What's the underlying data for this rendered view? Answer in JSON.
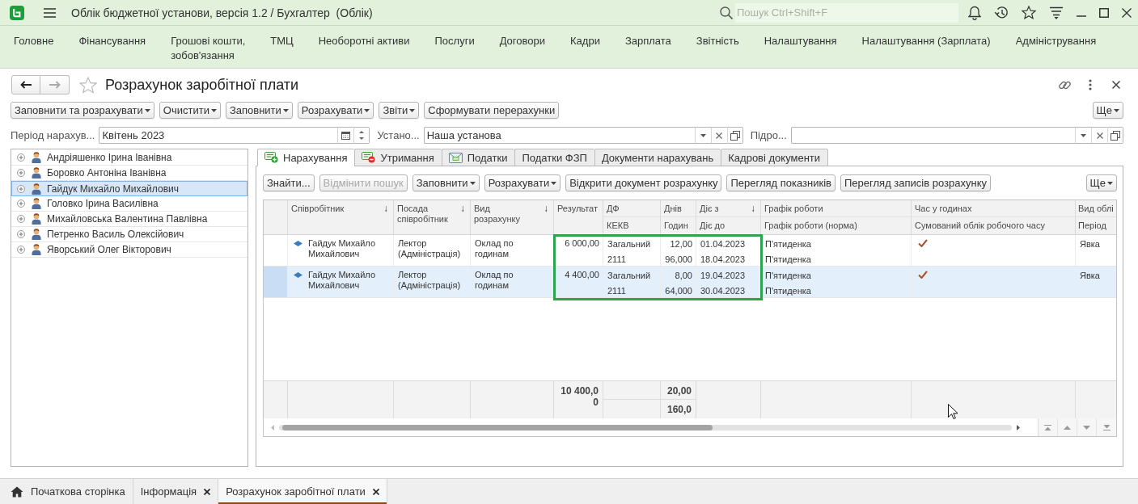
{
  "app": {
    "title": "Облік бюджетної установи, версія 1.2 / Бухгалтер  (Облік)",
    "search": {
      "placeholder": "Пошук Ctrl+Shift+F"
    }
  },
  "sections": [
    "Головне",
    "Фінансування",
    "Грошові кошти,\nзобов'язання",
    "ТМЦ",
    "Необоротні активи",
    "Послуги",
    "Договори",
    "Кадри",
    "Зарплата",
    "Звітність",
    "Налаштування",
    "Налаштування (Зарплата)",
    "Адміністрування"
  ],
  "form": {
    "title": "Розрахунок заробітної плати",
    "favorite": false,
    "navigation": {
      "back_disabled": false,
      "forward_disabled": true
    },
    "commands": [
      {
        "label": "Заповнити та розрахувати",
        "menu": true
      },
      {
        "label": "Очистити",
        "menu": true
      },
      {
        "label": "Заповнити",
        "menu": true
      },
      {
        "label": "Розрахувати",
        "menu": true
      },
      {
        "label": "Звіти",
        "menu": true
      },
      {
        "label": "Сформувати перерахунки",
        "menu": false
      }
    ],
    "more": "Ще",
    "fields": [
      {
        "kind": "period",
        "label": "Період нарахув...",
        "value": "Квітень 2023"
      },
      {
        "kind": "reference",
        "label": "Устано...",
        "value": "Наша установа"
      },
      {
        "kind": "reference",
        "label": "Підро..."
      }
    ]
  },
  "employees": [
    {
      "name": "Андріяшенко Ірина Іванівна",
      "selected": false
    },
    {
      "name": "Боровко Антоніна Іванівна",
      "selected": false
    },
    {
      "name": "Гайдук Михайло Михайлович",
      "selected": true
    },
    {
      "name": "Головко Ірина Василівна",
      "selected": false
    },
    {
      "name": "Михайловська Валентина Павлівна",
      "selected": false
    },
    {
      "name": "Петренко Василь Олексійович",
      "selected": false
    },
    {
      "name": "Яворський Олег Вікторович",
      "selected": false
    }
  ],
  "tabs": [
    {
      "label": "Нарахування",
      "kind": "accrual",
      "selected": true
    },
    {
      "label": "Утримання",
      "kind": "deduction",
      "selected": false
    },
    {
      "label": "Податки",
      "kind": "tax",
      "selected": false
    },
    {
      "label": "Податки ФЗП",
      "kind": "plain",
      "selected": false
    },
    {
      "label": "Документи нарахувань",
      "kind": "plain",
      "selected": false
    },
    {
      "label": "Кадрові документи",
      "kind": "plain",
      "selected": false
    }
  ],
  "table": {
    "commands": [
      {
        "label": "Знайти...",
        "menu": false,
        "disabled": false
      },
      {
        "label": "Відмінити пошук",
        "menu": false,
        "disabled": true
      },
      {
        "label": "Заповнити",
        "menu": true,
        "disabled": false
      },
      {
        "label": "Розрахувати",
        "menu": true,
        "disabled": false
      },
      {
        "label": "Відкрити документ розрахунку",
        "menu": false,
        "disabled": false
      },
      {
        "label": "Перегляд показників",
        "menu": false,
        "disabled": false
      },
      {
        "label": "Перегляд записів розрахунку",
        "menu": false,
        "disabled": false
      }
    ],
    "more": "Ще",
    "columns": [
      {
        "top": "Співробітник",
        "sort": "↓"
      },
      {
        "top": "Посада співробітник",
        "sort": "↓"
      },
      {
        "top": "Вид розрахунку",
        "sort": "↓"
      },
      {
        "top": "Результат"
      },
      {
        "top": "ДФ",
        "bottom": "КЕКВ"
      },
      {
        "top": "Днів",
        "bottom": "Годин"
      },
      {
        "top": "Діє з",
        "bottom": "Діє до",
        "sort": "↓"
      },
      {
        "top": "Графік роботи",
        "bottom": "Графік роботи (норма)"
      },
      {
        "top": "Час у годинах",
        "bottom": "Сумований облік робочого часу"
      },
      {
        "top": "Вид облі",
        "bottom": "Період"
      }
    ],
    "rows": [
      {
        "selected": false,
        "employee": "Гайдук Михайло Михайлович",
        "position": "Лектор (Адміністрація)",
        "calculation": "Оклад по годинам",
        "result": "6 000,00",
        "fund": "Загальний",
        "kekv": "2111",
        "days": "12,00",
        "hours": "96,000",
        "from": "01.04.2023",
        "to": "18.04.2023",
        "schedule": "П'ятиденка",
        "schedule_norm": "П'ятиденка",
        "summed_hours": true,
        "accounting_kind": "Явка"
      },
      {
        "selected": true,
        "employee": "Гайдук Михайло Михайлович",
        "position": "Лектор (Адміністрація)",
        "calculation": "Оклад по годинам",
        "result": "4 400,00",
        "fund": "Загальний",
        "kekv": "2111",
        "days": "8,00",
        "hours": "64,000",
        "from": "19.04.2023",
        "to": "30.04.2023",
        "schedule": "П'ятиденка",
        "schedule_norm": "П'ятиденка",
        "summed_hours": true,
        "accounting_kind": "Явка"
      }
    ],
    "totals": {
      "result": "10 400,00",
      "days": "20,00",
      "hours": "160,0"
    },
    "highlight_frame": true
  },
  "window_tabs": [
    {
      "label": "Початкова сторінка",
      "kind": "home",
      "selected": false
    },
    {
      "label": "Інформація",
      "kind": "closable",
      "selected": false
    },
    {
      "label": "Розрахунок заробітної плати",
      "kind": "closable",
      "selected": true
    }
  ],
  "cursor_shown": true
}
